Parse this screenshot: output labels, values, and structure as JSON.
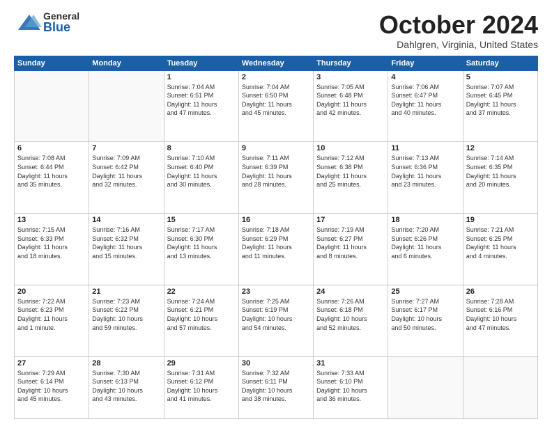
{
  "header": {
    "logo": {
      "general": "General",
      "blue": "Blue"
    },
    "title": "October 2024",
    "location": "Dahlgren, Virginia, United States"
  },
  "weekdays": [
    "Sunday",
    "Monday",
    "Tuesday",
    "Wednesday",
    "Thursday",
    "Friday",
    "Saturday"
  ],
  "weeks": [
    [
      {
        "day": "",
        "info": ""
      },
      {
        "day": "",
        "info": ""
      },
      {
        "day": "1",
        "info": "Sunrise: 7:04 AM\nSunset: 6:51 PM\nDaylight: 11 hours\nand 47 minutes."
      },
      {
        "day": "2",
        "info": "Sunrise: 7:04 AM\nSunset: 6:50 PM\nDaylight: 11 hours\nand 45 minutes."
      },
      {
        "day": "3",
        "info": "Sunrise: 7:05 AM\nSunset: 6:48 PM\nDaylight: 11 hours\nand 42 minutes."
      },
      {
        "day": "4",
        "info": "Sunrise: 7:06 AM\nSunset: 6:47 PM\nDaylight: 11 hours\nand 40 minutes."
      },
      {
        "day": "5",
        "info": "Sunrise: 7:07 AM\nSunset: 6:45 PM\nDaylight: 11 hours\nand 37 minutes."
      }
    ],
    [
      {
        "day": "6",
        "info": "Sunrise: 7:08 AM\nSunset: 6:44 PM\nDaylight: 11 hours\nand 35 minutes."
      },
      {
        "day": "7",
        "info": "Sunrise: 7:09 AM\nSunset: 6:42 PM\nDaylight: 11 hours\nand 32 minutes."
      },
      {
        "day": "8",
        "info": "Sunrise: 7:10 AM\nSunset: 6:40 PM\nDaylight: 11 hours\nand 30 minutes."
      },
      {
        "day": "9",
        "info": "Sunrise: 7:11 AM\nSunset: 6:39 PM\nDaylight: 11 hours\nand 28 minutes."
      },
      {
        "day": "10",
        "info": "Sunrise: 7:12 AM\nSunset: 6:38 PM\nDaylight: 11 hours\nand 25 minutes."
      },
      {
        "day": "11",
        "info": "Sunrise: 7:13 AM\nSunset: 6:36 PM\nDaylight: 11 hours\nand 23 minutes."
      },
      {
        "day": "12",
        "info": "Sunrise: 7:14 AM\nSunset: 6:35 PM\nDaylight: 11 hours\nand 20 minutes."
      }
    ],
    [
      {
        "day": "13",
        "info": "Sunrise: 7:15 AM\nSunset: 6:33 PM\nDaylight: 11 hours\nand 18 minutes."
      },
      {
        "day": "14",
        "info": "Sunrise: 7:16 AM\nSunset: 6:32 PM\nDaylight: 11 hours\nand 15 minutes."
      },
      {
        "day": "15",
        "info": "Sunrise: 7:17 AM\nSunset: 6:30 PM\nDaylight: 11 hours\nand 13 minutes."
      },
      {
        "day": "16",
        "info": "Sunrise: 7:18 AM\nSunset: 6:29 PM\nDaylight: 11 hours\nand 11 minutes."
      },
      {
        "day": "17",
        "info": "Sunrise: 7:19 AM\nSunset: 6:27 PM\nDaylight: 11 hours\nand 8 minutes."
      },
      {
        "day": "18",
        "info": "Sunrise: 7:20 AM\nSunset: 6:26 PM\nDaylight: 11 hours\nand 6 minutes."
      },
      {
        "day": "19",
        "info": "Sunrise: 7:21 AM\nSunset: 6:25 PM\nDaylight: 11 hours\nand 4 minutes."
      }
    ],
    [
      {
        "day": "20",
        "info": "Sunrise: 7:22 AM\nSunset: 6:23 PM\nDaylight: 11 hours\nand 1 minute."
      },
      {
        "day": "21",
        "info": "Sunrise: 7:23 AM\nSunset: 6:22 PM\nDaylight: 10 hours\nand 59 minutes."
      },
      {
        "day": "22",
        "info": "Sunrise: 7:24 AM\nSunset: 6:21 PM\nDaylight: 10 hours\nand 57 minutes."
      },
      {
        "day": "23",
        "info": "Sunrise: 7:25 AM\nSunset: 6:19 PM\nDaylight: 10 hours\nand 54 minutes."
      },
      {
        "day": "24",
        "info": "Sunrise: 7:26 AM\nSunset: 6:18 PM\nDaylight: 10 hours\nand 52 minutes."
      },
      {
        "day": "25",
        "info": "Sunrise: 7:27 AM\nSunset: 6:17 PM\nDaylight: 10 hours\nand 50 minutes."
      },
      {
        "day": "26",
        "info": "Sunrise: 7:28 AM\nSunset: 6:16 PM\nDaylight: 10 hours\nand 47 minutes."
      }
    ],
    [
      {
        "day": "27",
        "info": "Sunrise: 7:29 AM\nSunset: 6:14 PM\nDaylight: 10 hours\nand 45 minutes."
      },
      {
        "day": "28",
        "info": "Sunrise: 7:30 AM\nSunset: 6:13 PM\nDaylight: 10 hours\nand 43 minutes."
      },
      {
        "day": "29",
        "info": "Sunrise: 7:31 AM\nSunset: 6:12 PM\nDaylight: 10 hours\nand 41 minutes."
      },
      {
        "day": "30",
        "info": "Sunrise: 7:32 AM\nSunset: 6:11 PM\nDaylight: 10 hours\nand 38 minutes."
      },
      {
        "day": "31",
        "info": "Sunrise: 7:33 AM\nSunset: 6:10 PM\nDaylight: 10 hours\nand 36 minutes."
      },
      {
        "day": "",
        "info": ""
      },
      {
        "day": "",
        "info": ""
      }
    ]
  ]
}
